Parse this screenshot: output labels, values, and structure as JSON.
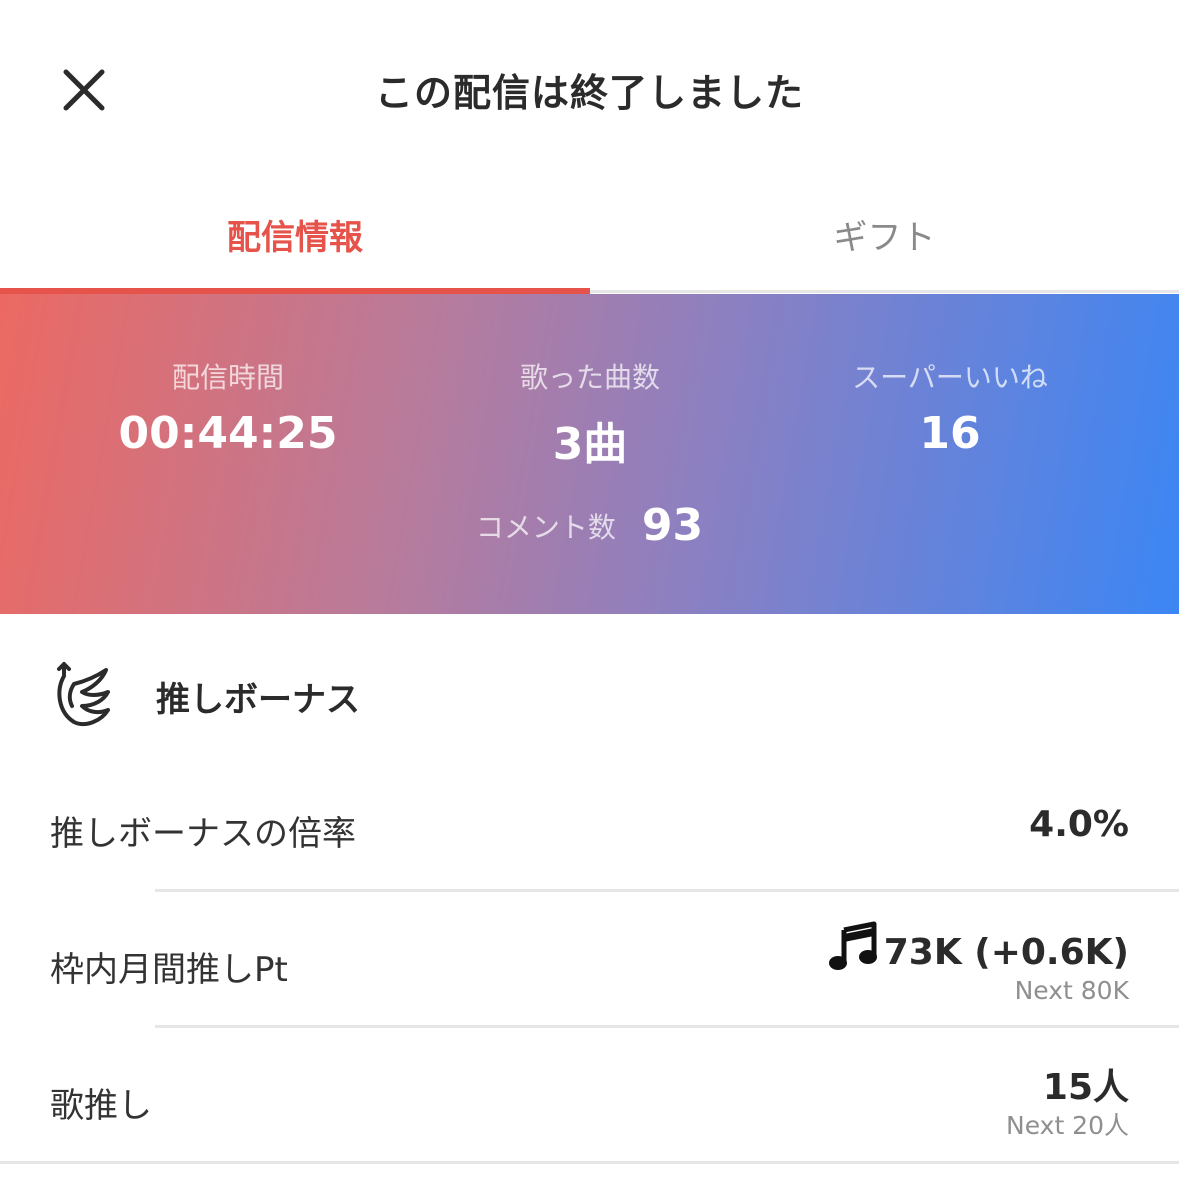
{
  "header": {
    "title": "この配信は終了しました",
    "close_icon": "close-icon"
  },
  "tabs": [
    {
      "label": "配信情報",
      "active": true
    },
    {
      "label": "ギフト",
      "active": false
    }
  ],
  "colors": {
    "accent": "#e5534b",
    "gradient_start": "#ec6962",
    "gradient_end": "#3b86f5"
  },
  "stats": {
    "duration": {
      "label": "配信時間",
      "value": "00:44:25"
    },
    "songs": {
      "label": "歌った曲数",
      "value": "3曲"
    },
    "super_likes": {
      "label": "スーパーいいね",
      "value": "16"
    },
    "comments": {
      "label": "コメント数",
      "value": "93"
    }
  },
  "bonus": {
    "title": "推しボーナス",
    "icon": "wing-icon",
    "rows": [
      {
        "label": "推しボーナスの倍率",
        "value": "4.0%"
      },
      {
        "label": "枠内月間推しPt",
        "value": "73K (+0.6K)",
        "sub": "Next 80K",
        "icon": "music-note-icon"
      },
      {
        "label": "歌推し",
        "value": "15人",
        "sub": "Next 20人"
      }
    ]
  }
}
